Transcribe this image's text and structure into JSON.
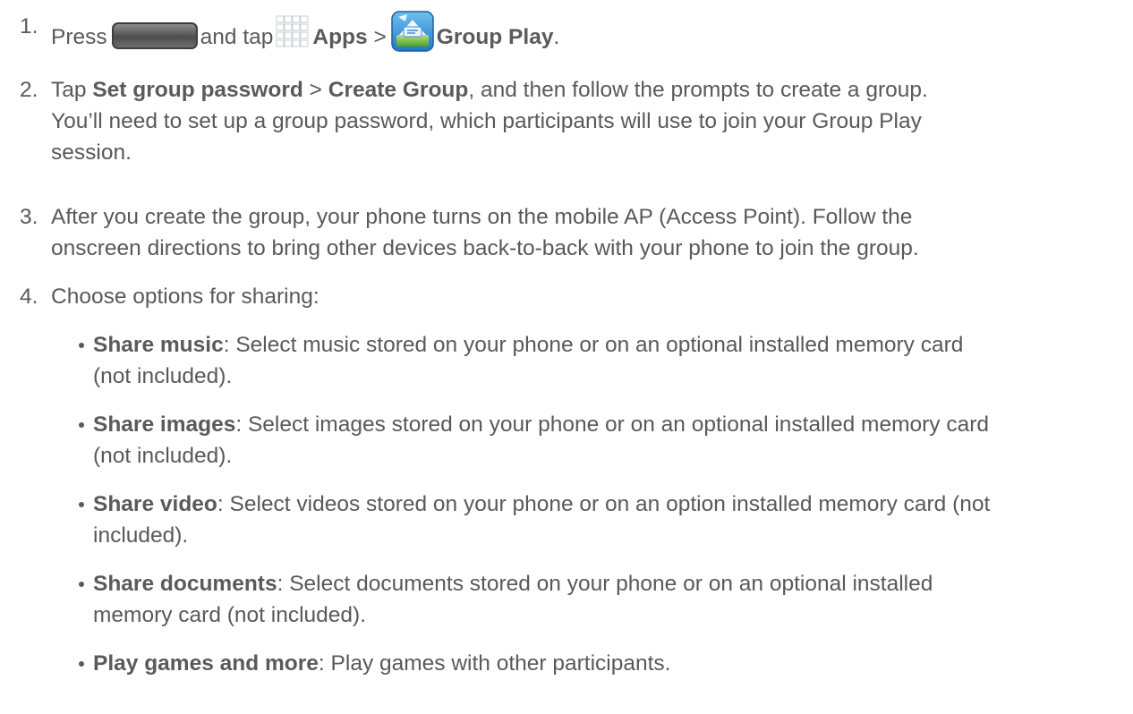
{
  "steps": [
    {
      "number": "1.",
      "press": "Press",
      "and_tap": "and tap",
      "apps": "Apps",
      "separator": ">",
      "group_play": "Group Play",
      "end": "."
    },
    {
      "number": "2.",
      "tap": "Tap",
      "set_group_password": "Set group password",
      "separator": ">",
      "create_group": "Create Group",
      "line1_rest": ", and then follow the prompts to create a group.",
      "line2": "You’ll need to set up a group password, which participants will use to join your Group Play",
      "line3": "session."
    },
    {
      "number": "3.",
      "line1": "After you create the group, your phone turns on the mobile AP (Access Point). Follow the",
      "line2": "onscreen directions to bring other devices back-to-back with your phone to join the group."
    },
    {
      "number": "4.",
      "text": "Choose options for sharing:"
    }
  ],
  "bullets": [
    {
      "term": "Share music",
      "line1": ": Select music stored on your phone or on an optional installed memory card",
      "line2": "(not included)."
    },
    {
      "term": "Share images",
      "line1": ": Select images stored on your phone or on an optional installed memory card",
      "line2": "(not included)."
    },
    {
      "term": "Share video",
      "line1": ": Select videos stored on your phone or on an option installed memory card (not",
      "line2": "included)."
    },
    {
      "term": "Share documents",
      "line1": ": Select documents stored on your phone or on an optional installed",
      "line2": "memory card (not included)."
    },
    {
      "term": "Play games and more",
      "line1": ": Play games with other participants.",
      "line2": ""
    }
  ],
  "icons": {
    "home_key": "home-key-icon",
    "apps": "apps-grid-icon",
    "group_play": "group-play-app-icon"
  },
  "colors": {
    "text": "#595959"
  }
}
